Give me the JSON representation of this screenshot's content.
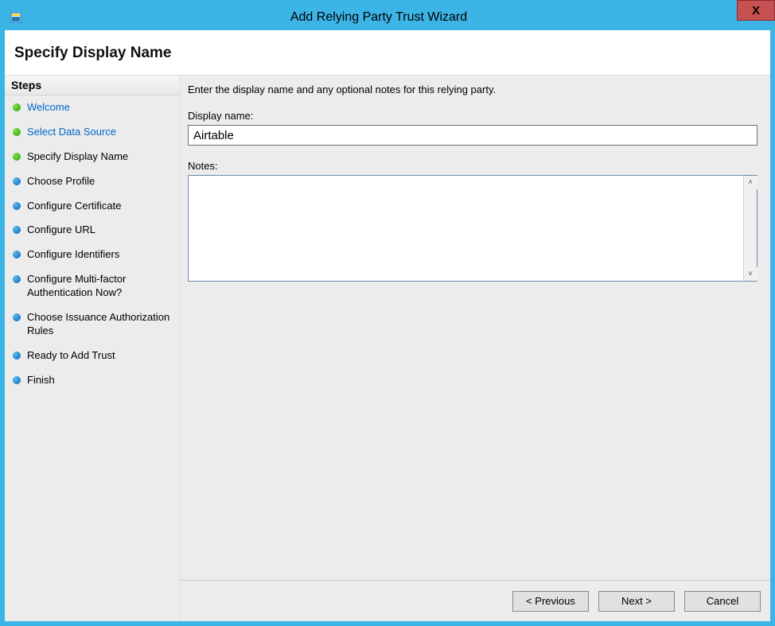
{
  "window": {
    "title": "Add Relying Party Trust Wizard",
    "close_glyph": "X"
  },
  "header": {
    "subtitle": "Specify Display Name"
  },
  "steps": {
    "header": "Steps",
    "items": [
      {
        "label": "Welcome",
        "bullet": "done",
        "state": "link"
      },
      {
        "label": "Select Data Source",
        "bullet": "done",
        "state": "link"
      },
      {
        "label": "Specify Display Name",
        "bullet": "done",
        "state": "current"
      },
      {
        "label": "Choose Profile",
        "bullet": "todo",
        "state": "future"
      },
      {
        "label": "Configure Certificate",
        "bullet": "todo",
        "state": "future"
      },
      {
        "label": "Configure URL",
        "bullet": "todo",
        "state": "future"
      },
      {
        "label": "Configure Identifiers",
        "bullet": "todo",
        "state": "future"
      },
      {
        "label": "Configure Multi-factor Authentication Now?",
        "bullet": "todo",
        "state": "future"
      },
      {
        "label": "Choose Issuance Authorization Rules",
        "bullet": "todo",
        "state": "future"
      },
      {
        "label": "Ready to Add Trust",
        "bullet": "todo",
        "state": "future"
      },
      {
        "label": "Finish",
        "bullet": "todo",
        "state": "future"
      }
    ]
  },
  "content": {
    "instruction": "Enter the display name and any optional notes for this relying party.",
    "display_name_label": "Display name:",
    "display_name_value": "Airtable",
    "notes_label": "Notes:",
    "notes_value": ""
  },
  "buttons": {
    "previous": "< Previous",
    "next": "Next >",
    "cancel": "Cancel"
  }
}
